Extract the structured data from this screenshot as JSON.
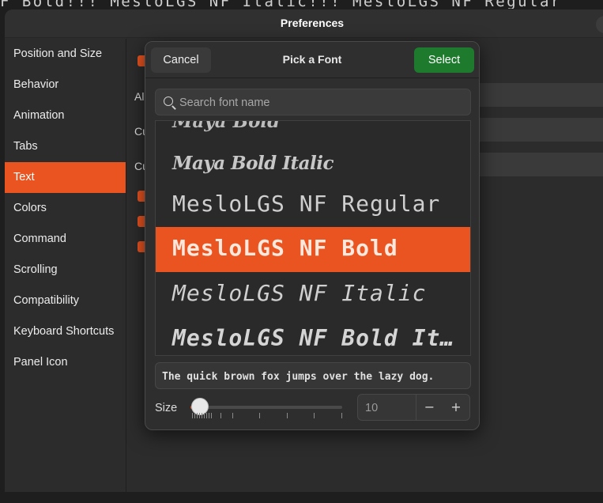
{
  "terminal": {
    "visible_text": "NF Bold!!!  MesloLGS NF Italic!!!  MesloLGS NF Regular"
  },
  "preferences": {
    "title": "Preferences",
    "sidebar": {
      "items": [
        {
          "label": "Position and Size",
          "active": false
        },
        {
          "label": "Behavior",
          "active": false
        },
        {
          "label": "Animation",
          "active": false
        },
        {
          "label": "Tabs",
          "active": false
        },
        {
          "label": "Text",
          "active": true
        },
        {
          "label": "Colors",
          "active": false
        },
        {
          "label": "Command",
          "active": false
        },
        {
          "label": "Scrolling",
          "active": false
        },
        {
          "label": "Compatibility",
          "active": false
        },
        {
          "label": "Keyboard Shortcuts",
          "active": false
        },
        {
          "label": "Panel Icon",
          "active": false
        }
      ]
    },
    "content": {
      "partial_labels": [
        "Al",
        "Cu",
        "Cu"
      ]
    }
  },
  "font_dialog": {
    "title": "Pick a Font",
    "cancel_label": "Cancel",
    "select_label": "Select",
    "search_placeholder": "Search font name",
    "fonts": [
      {
        "name": "Maya Bold",
        "selected": false
      },
      {
        "name": "Maya Bold Italic",
        "selected": false
      },
      {
        "name": "MesloLGS NF Regular",
        "selected": false
      },
      {
        "name": "MesloLGS NF Bold",
        "selected": true
      },
      {
        "name": "MesloLGS NF Italic",
        "selected": false
      },
      {
        "name": "MesloLGS NF Bold It…",
        "selected": false
      }
    ],
    "preview_text": "The quick brown fox jumps over the lazy dog.",
    "size_label": "Size",
    "size_value": "10",
    "size_slider_fraction": 0.06,
    "minus_label": "−",
    "plus_label": "+"
  },
  "colors": {
    "accent": "#e95420",
    "select_button": "#1e7b2e",
    "window_bg": "#2c2c2c"
  }
}
